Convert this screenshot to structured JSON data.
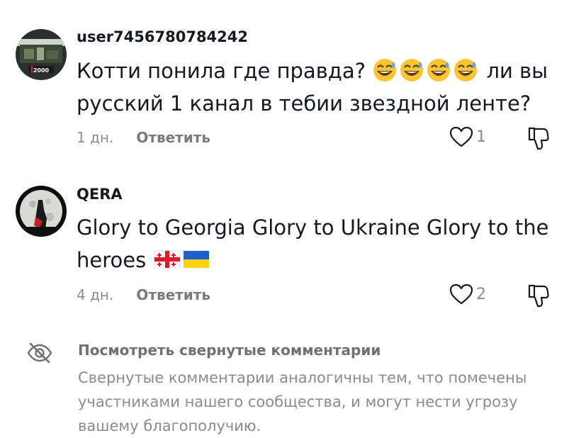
{
  "comments": [
    {
      "username": "user7456780784242",
      "text_before_emoji": "Котти понила где правда? ",
      "emoji_count": 4,
      "text_after_emoji": " ли вы русский 1 канал в тебии звездной ленте?",
      "avatar_badge": "2000",
      "time": "1 дн.",
      "reply_label": "Ответить",
      "likes": "1"
    },
    {
      "username": "QERA",
      "text": "Glory to Georgia Glory to Ukraine Glory to the heroes",
      "flags": [
        "georgia-flag",
        "ukraine-flag"
      ],
      "time": "4 дн.",
      "reply_label": "Ответить",
      "likes": "2"
    }
  ],
  "collapsed": {
    "title": "Посмотреть свернутые комментарии",
    "description": "Свернутые комментарии аналогичны тем, что помечены участниками нашего сообщества, и могут нести угрозу вашему благополучию."
  },
  "icons": {
    "like": "heart-outline-icon",
    "dislike": "thumbs-down-outline-icon",
    "collapsed": "eye-crossed-icon"
  },
  "colors": {
    "primary_text": "#161823",
    "secondary_text": "#8a8b91",
    "emoji_yellow": "#f9c531",
    "ukraine_blue": "#1c5fd1",
    "ukraine_yellow": "#f8d20f",
    "georgia_red": "#e0192b"
  }
}
